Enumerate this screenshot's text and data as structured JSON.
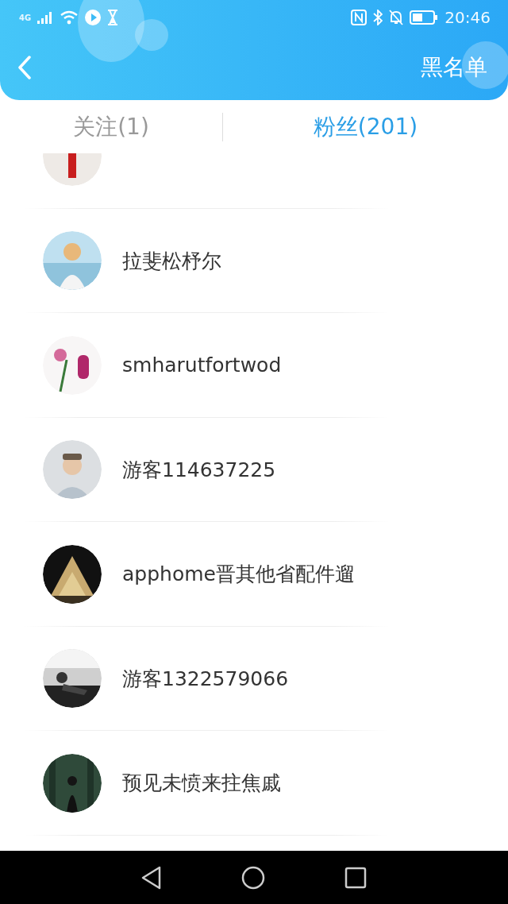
{
  "status_bar": {
    "network": "4G",
    "time": "20:46"
  },
  "header": {
    "title": "黑名单"
  },
  "tabs": [
    {
      "label": "关注(1)",
      "selected": false
    },
    {
      "label": "粉丝(201)",
      "selected": true
    }
  ],
  "users": [
    {
      "avatar": {
        "kind": "picture"
      }
    },
    {
      "name": "拉斐松杼尔",
      "avatar": {
        "kind": "picture"
      }
    },
    {
      "name": "smharutfortwod",
      "avatar": {
        "kind": "picture"
      }
    },
    {
      "name": "游客114637225",
      "avatar": {
        "kind": "picture"
      }
    },
    {
      "name": "apphome晋其他省配件遛",
      "avatar": {
        "kind": "picture"
      }
    },
    {
      "name": "游客1322579066",
      "avatar": {
        "kind": "picture"
      }
    },
    {
      "name": "预见未愤来拄焦戚",
      "avatar": {
        "kind": "picture"
      }
    }
  ]
}
